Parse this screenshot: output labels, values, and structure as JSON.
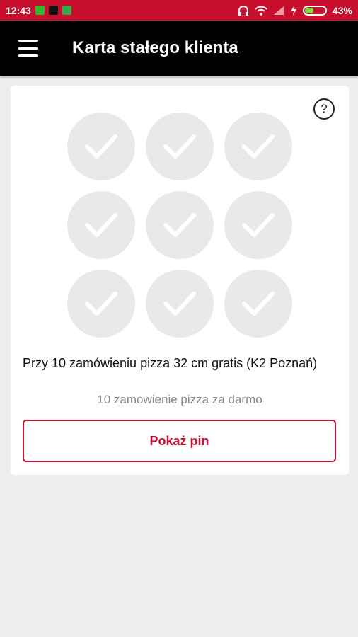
{
  "status_bar": {
    "time": "12:43",
    "battery_percent": "43%",
    "battery_level": 0.43,
    "icons": [
      "notification-icon",
      "a-icon",
      "notification-icon-2",
      "headphones-icon",
      "wifi-icon",
      "signal-icon",
      "charging-icon",
      "battery-icon"
    ]
  },
  "appbar": {
    "title": "Karta stałego klienta",
    "menu_icon": "hamburger-menu-icon"
  },
  "card": {
    "help_label": "?",
    "stamps": {
      "total": 9,
      "collected": 0,
      "icon": "check-icon"
    },
    "description": "Przy 10 zamówieniu pizza 32 cm gratis (K2 Poznań)",
    "reward_note": "10 zamowienie pizza za darmo",
    "pin_button_label": "Pokaż pin"
  },
  "colors": {
    "brand_red": "#c8102e",
    "appbar_bg": "#000000",
    "page_bg": "#eeeeee",
    "stamp_bg": "#e9e9e9"
  }
}
